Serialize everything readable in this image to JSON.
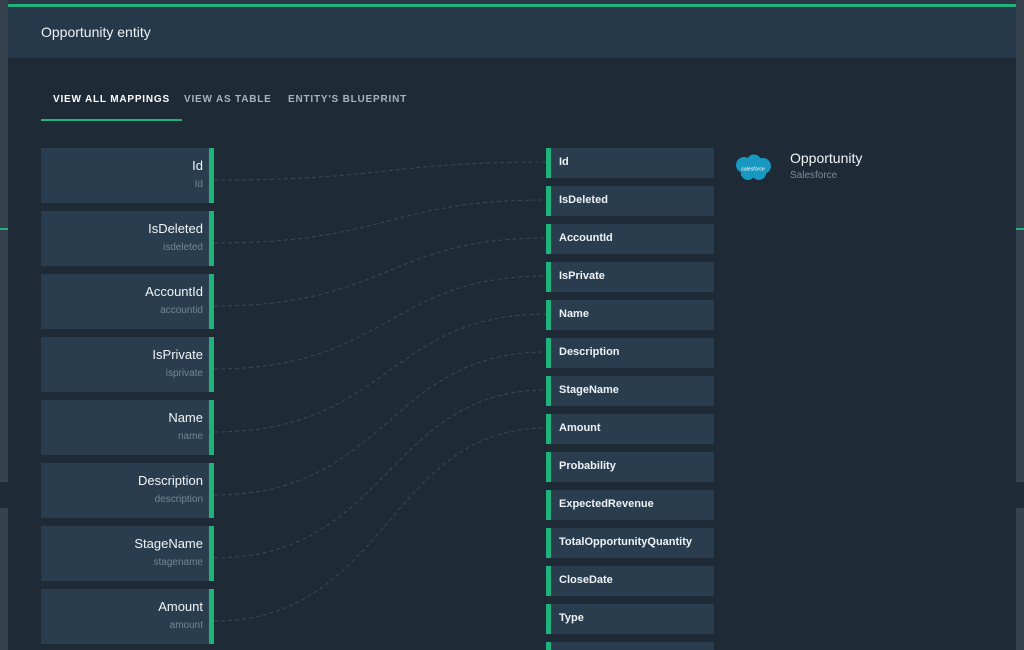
{
  "modal": {
    "title": "Opportunity entity"
  },
  "tabs": [
    {
      "label": "VIEW ALL MAPPINGS",
      "active": true
    },
    {
      "label": "VIEW AS TABLE",
      "active": false
    },
    {
      "label": "ENTITY'S BLUEPRINT",
      "active": false
    }
  ],
  "source_fields": [
    {
      "label": "Id",
      "sublabel": "Id"
    },
    {
      "label": "IsDeleted",
      "sublabel": "isdeleted"
    },
    {
      "label": "AccountId",
      "sublabel": "accountid"
    },
    {
      "label": "IsPrivate",
      "sublabel": "isprivate"
    },
    {
      "label": "Name",
      "sublabel": "name"
    },
    {
      "label": "Description",
      "sublabel": "description"
    },
    {
      "label": "StageName",
      "sublabel": "stagename"
    },
    {
      "label": "Amount",
      "sublabel": "amount"
    }
  ],
  "target_fields": [
    "Id",
    "IsDeleted",
    "AccountId",
    "IsPrivate",
    "Name",
    "Description",
    "StageName",
    "Amount",
    "Probability",
    "ExpectedRevenue",
    "TotalOpportunityQuantity",
    "CloseDate",
    "Type",
    ""
  ],
  "target_entity": {
    "name": "Opportunity",
    "source": "Salesforce",
    "logo_icon": "salesforce-cloud-icon",
    "logo_text": "salesforce"
  },
  "colors": {
    "accent": "#1fb27a",
    "card": "#2a3d4f",
    "header": "#26394a",
    "modal_bg": "#1e2a35",
    "salesforce_blue": "#1798c1"
  }
}
